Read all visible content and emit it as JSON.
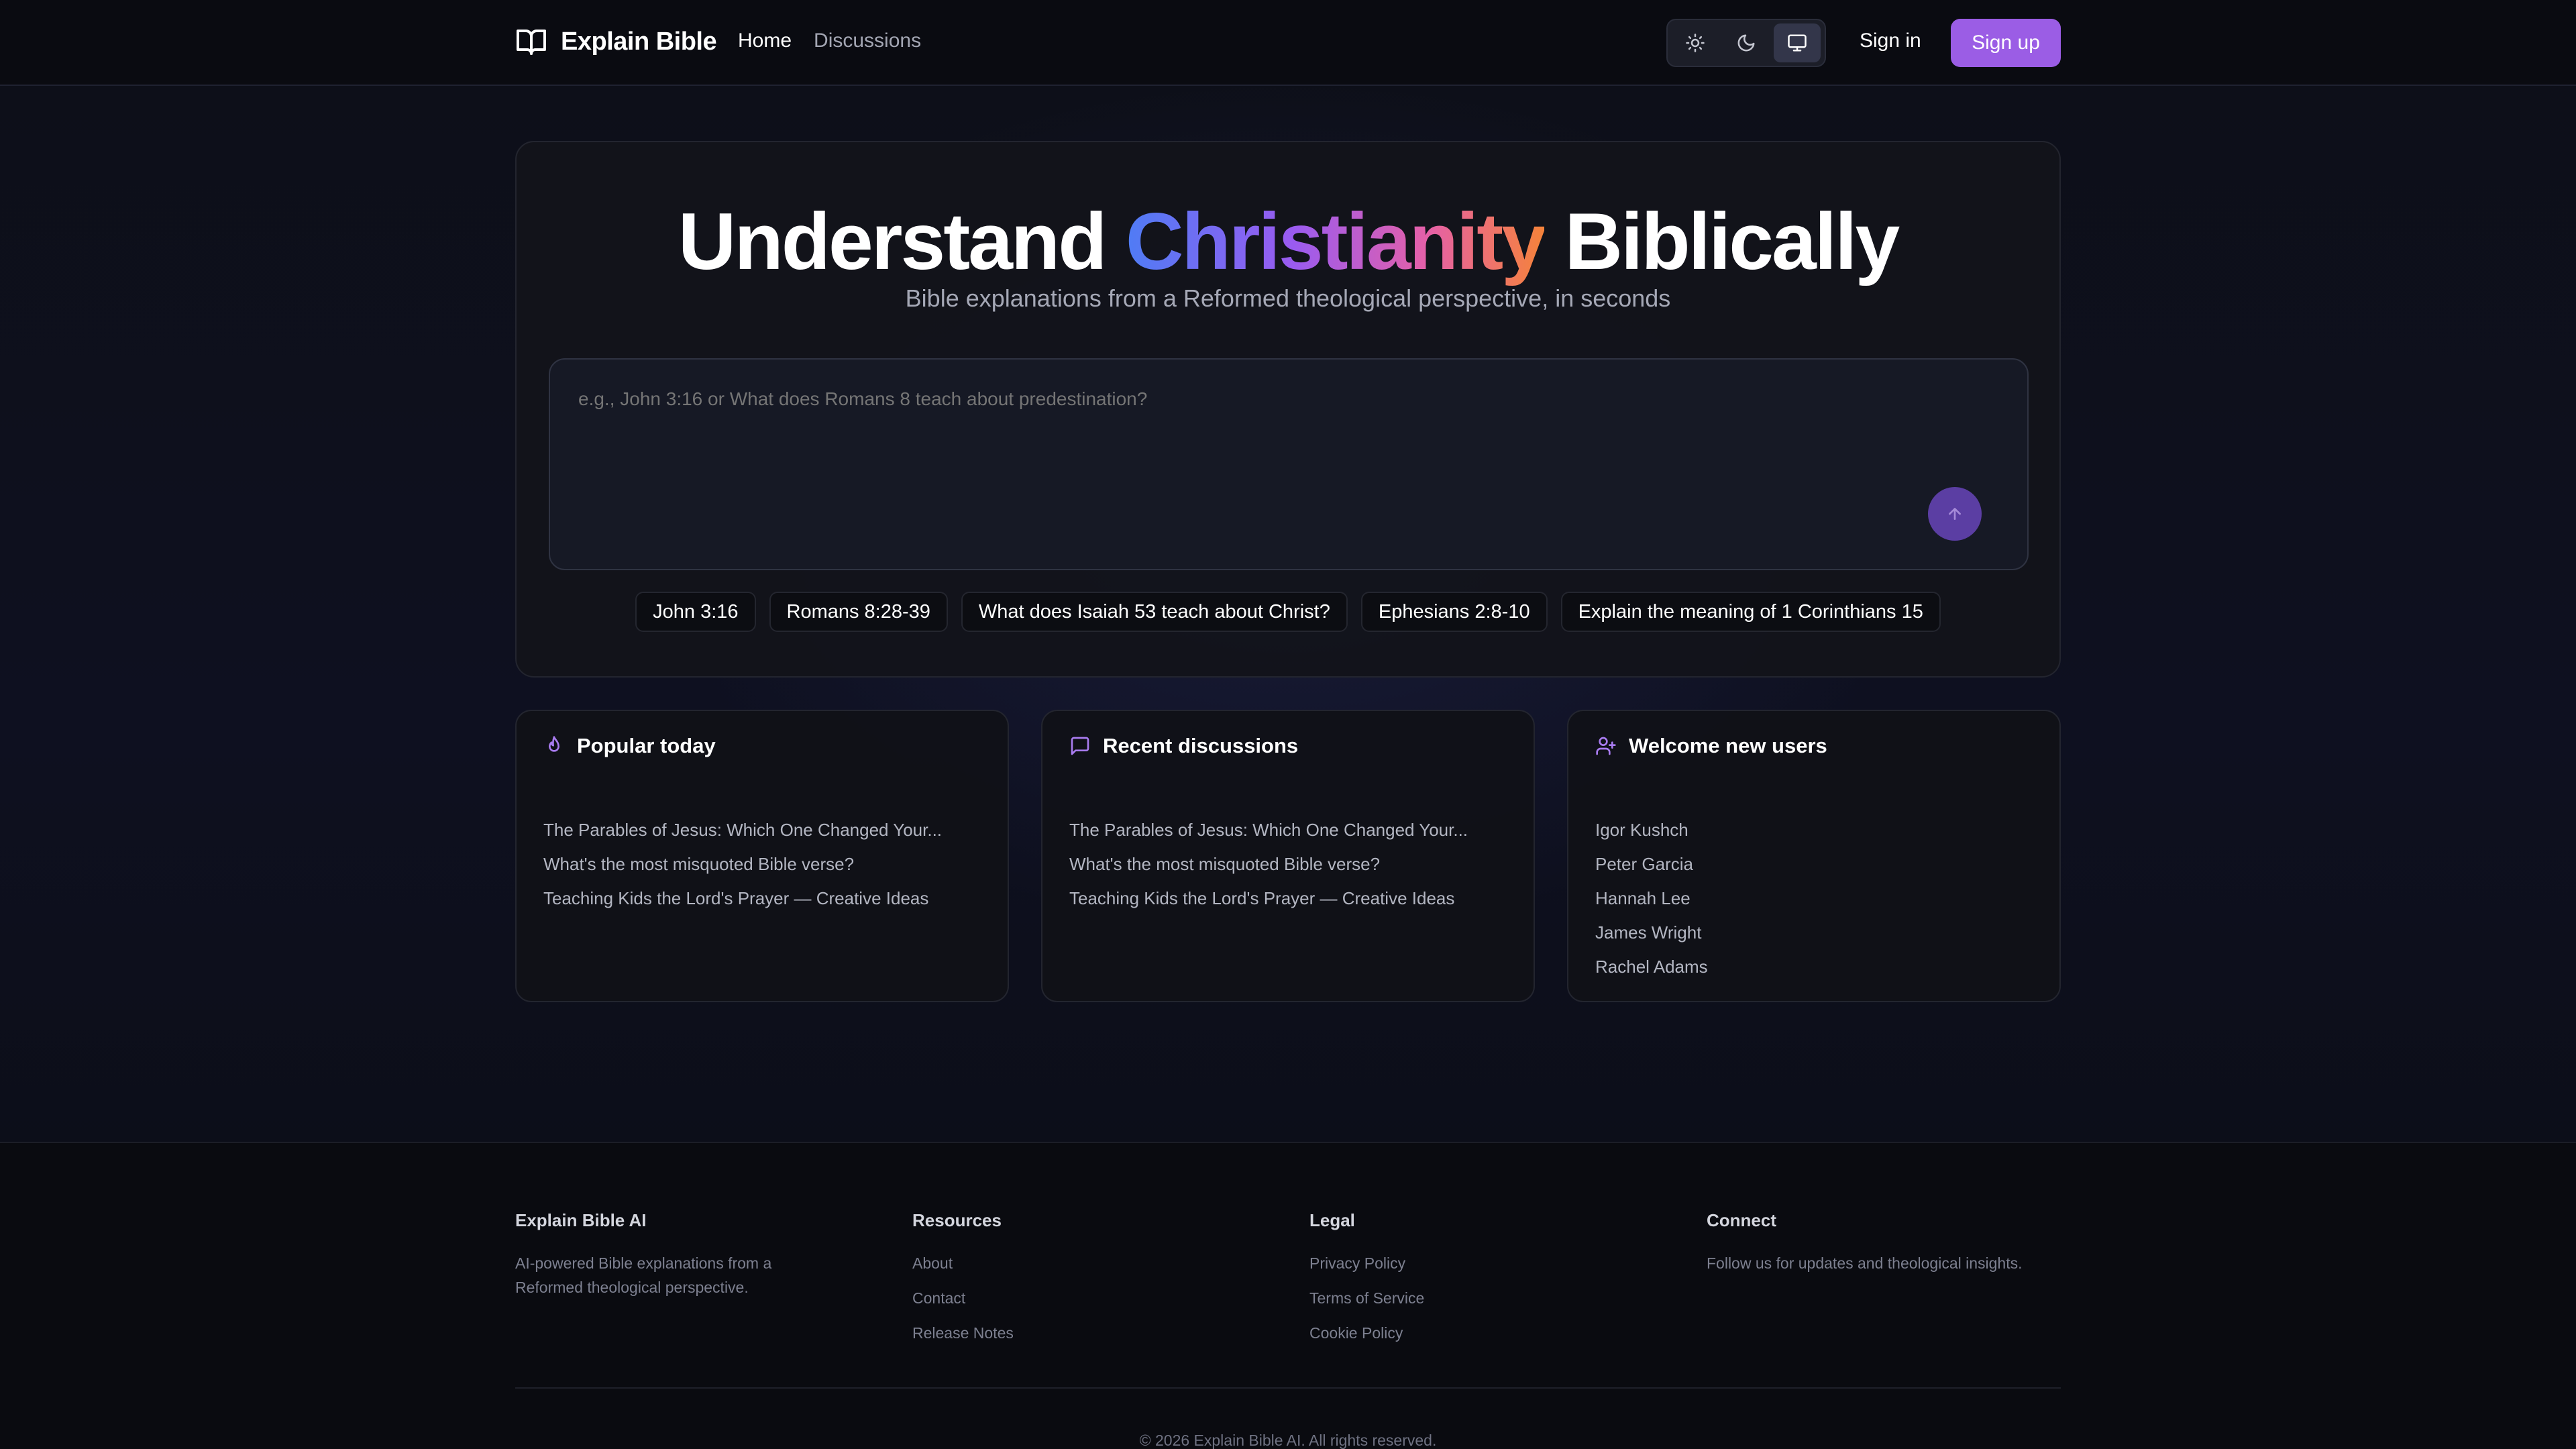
{
  "header": {
    "brand": "Explain Bible",
    "nav": [
      {
        "label": "Home",
        "active": true
      },
      {
        "label": "Discussions",
        "active": false
      }
    ],
    "theme_options": [
      "sun-icon",
      "moon-icon",
      "monitor-icon"
    ],
    "theme_selected": "monitor-icon",
    "signin_label": "Sign in",
    "signup_label": "Sign up"
  },
  "hero": {
    "title_before": "Understand ",
    "title_highlight": "Christianity",
    "title_after": " Biblically",
    "subtitle": "Bible explanations from a Reformed theological perspective, in seconds",
    "input_placeholder": "e.g., John 3:16 or What does Romans 8 teach about predestination?",
    "input_value": "",
    "chips": [
      "John 3:16",
      "Romans 8:28-39",
      "What does Isaiah 53 teach about Christ?",
      "Ephesians 2:8-10",
      "Explain the meaning of 1 Corinthians 15"
    ]
  },
  "cards": {
    "popular": {
      "title": "Popular today",
      "icon": "flame-icon",
      "items": [
        "The Parables of Jesus: Which One Changed Your...",
        "What's the most misquoted Bible verse?",
        "Teaching Kids the Lord's Prayer — Creative Ideas"
      ]
    },
    "recent": {
      "title": "Recent discussions",
      "icon": "message-square-icon",
      "items": [
        "The Parables of Jesus: Which One Changed Your...",
        "What's the most misquoted Bible verse?",
        "Teaching Kids the Lord's Prayer — Creative Ideas"
      ]
    },
    "welcome": {
      "title": "Welcome new users",
      "icon": "user-plus-icon",
      "items": [
        "Igor Kushch",
        "Peter Garcia",
        "Hannah Lee",
        "James Wright",
        "Rachel Adams"
      ]
    }
  },
  "footer": {
    "about": {
      "title": "Explain Bible AI",
      "text": "AI-powered Bible explanations from a Reformed theological perspective."
    },
    "resources": {
      "title": "Resources",
      "links": [
        "About",
        "Contact",
        "Release Notes"
      ]
    },
    "legal": {
      "title": "Legal",
      "links": [
        "Privacy Policy",
        "Terms of Service",
        "Cookie Policy"
      ]
    },
    "connect": {
      "title": "Connect",
      "text": "Follow us for updates and theological insights."
    },
    "copyright": "© 2026 Explain Bible AI. All rights reserved."
  },
  "colors": {
    "accent": "#9b5de5",
    "send_button": "#5b3ea3",
    "gradient": [
      "#4f7cf5",
      "#9a5bf0",
      "#e560a8",
      "#f5833a"
    ]
  }
}
